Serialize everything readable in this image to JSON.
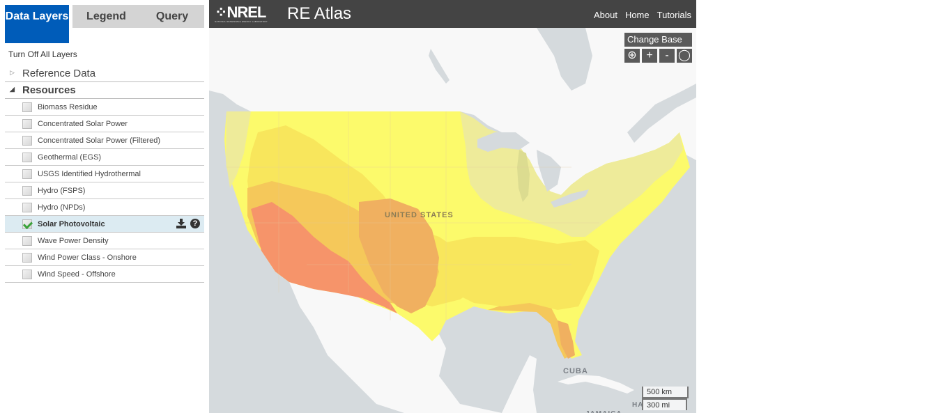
{
  "sidebar": {
    "tabs": [
      {
        "label": "Data Layers",
        "active": true
      },
      {
        "label": "Legend",
        "active": false
      },
      {
        "label": "Query",
        "active": false
      }
    ],
    "turn_off_all": "Turn Off All Layers",
    "sections": [
      {
        "label": "Reference Data",
        "expanded": false
      },
      {
        "label": "Resources",
        "expanded": true
      }
    ],
    "layers": [
      {
        "label": "Biomass Residue",
        "checked": false
      },
      {
        "label": "Concentrated Solar Power",
        "checked": false
      },
      {
        "label": "Concentrated Solar Power (Filtered)",
        "checked": false
      },
      {
        "label": "Geothermal (EGS)",
        "checked": false
      },
      {
        "label": "USGS Identified Hydrothermal",
        "checked": false
      },
      {
        "label": "Hydro (FSPS)",
        "checked": false
      },
      {
        "label": "Hydro (NPDs)",
        "checked": false
      },
      {
        "label": "Solar Photovoltaic",
        "checked": true
      },
      {
        "label": "Wave Power Density",
        "checked": false
      },
      {
        "label": "Wind Power Class - Onshore",
        "checked": false
      },
      {
        "label": "Wind Speed - Offshore",
        "checked": false
      }
    ],
    "selected_layer_icons": [
      "download-icon",
      "help-icon"
    ],
    "help_glyph": "?"
  },
  "header": {
    "logo_text": "NREL",
    "logo_subtext": "NATIONAL RENEWABLE ENERGY LABORATORY",
    "title": "RE Atlas",
    "nav": [
      "About",
      "Home",
      "Tutorials"
    ]
  },
  "map": {
    "change_base_label": "Change Base",
    "controls": [
      {
        "name": "zoom-box-icon",
        "glyph": "⊕"
      },
      {
        "name": "zoom-in-icon",
        "glyph": "+"
      },
      {
        "name": "zoom-out-icon",
        "glyph": "-"
      },
      {
        "name": "locate-icon",
        "glyph": "◯"
      }
    ],
    "scale": {
      "km": "500 km",
      "mi": "300 mi"
    },
    "labels": {
      "us": "UNITED STATES",
      "cuba": "CUBA",
      "jamaica": "JAMAICA",
      "haiti": "HA"
    },
    "colors": {
      "water": "#d5dadd",
      "land": "#f8f8f8",
      "pv_low": "#eeeb9a",
      "pv_mid_low": "#fcfa6b",
      "pv_mid": "#f8e65c",
      "pv_mid_high": "#f5c85a",
      "pv_high": "#f0b060",
      "pv_max": "#f6946a"
    }
  }
}
